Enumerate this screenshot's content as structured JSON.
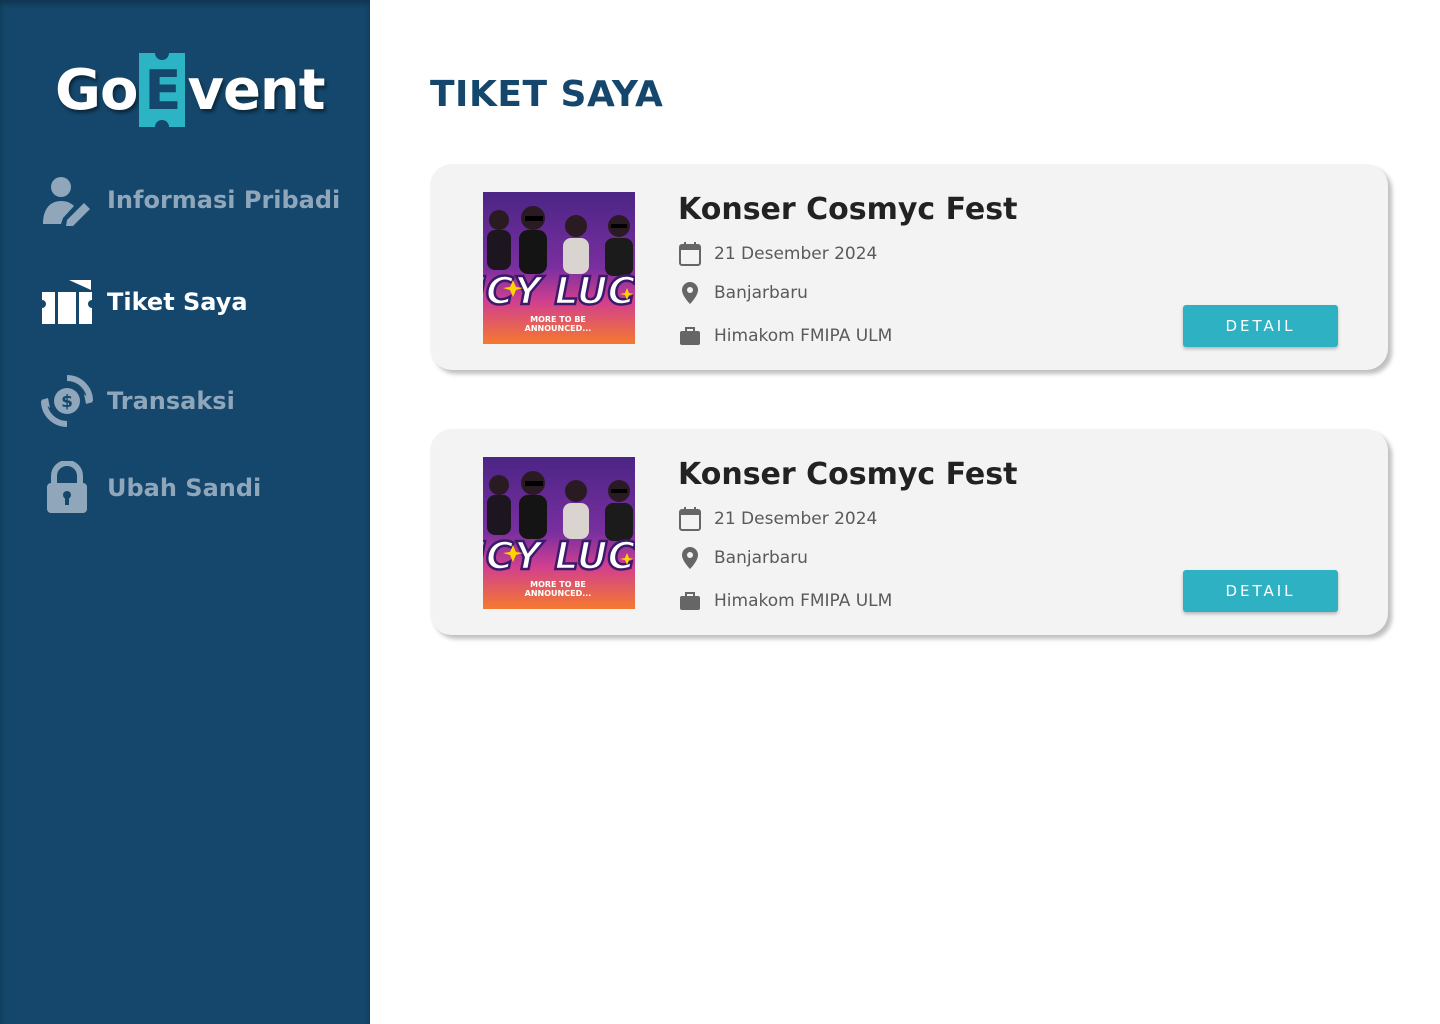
{
  "brand": {
    "logo_left": "Go",
    "logo_e": "E",
    "logo_right": "vent"
  },
  "sidebar": {
    "items": [
      {
        "label": "Informasi Pribadi",
        "icon": "user-edit-icon",
        "active": false
      },
      {
        "label": "Tiket Saya",
        "icon": "ticket-icon",
        "active": true
      },
      {
        "label": "Transaksi",
        "icon": "transaction-icon",
        "active": false
      },
      {
        "label": "Ubah Sandi",
        "icon": "lock-icon",
        "active": false
      }
    ]
  },
  "main": {
    "title": "TIKET SAYA",
    "tickets": [
      {
        "title": "Konser Cosmyc Fest",
        "date": "21 Desember 2024",
        "location": "Banjarbaru",
        "organizer": "Himakom FMIPA ULM",
        "poster_text": "LUCY",
        "poster_sub": "MORE TO BE ANNOUNCED...",
        "button": "DETAIL"
      },
      {
        "title": "Konser Cosmyc Fest",
        "date": "21 Desember 2024",
        "location": "Banjarbaru",
        "organizer": "Himakom FMIPA ULM",
        "poster_text": "LUCY",
        "poster_sub": "MORE TO BE ANNOUNCED...",
        "button": "DETAIL"
      }
    ]
  },
  "colors": {
    "sidebar_bg": "#14476b",
    "accent": "#2eb1c2",
    "title": "#14476b",
    "card_bg": "#f3f3f3"
  }
}
